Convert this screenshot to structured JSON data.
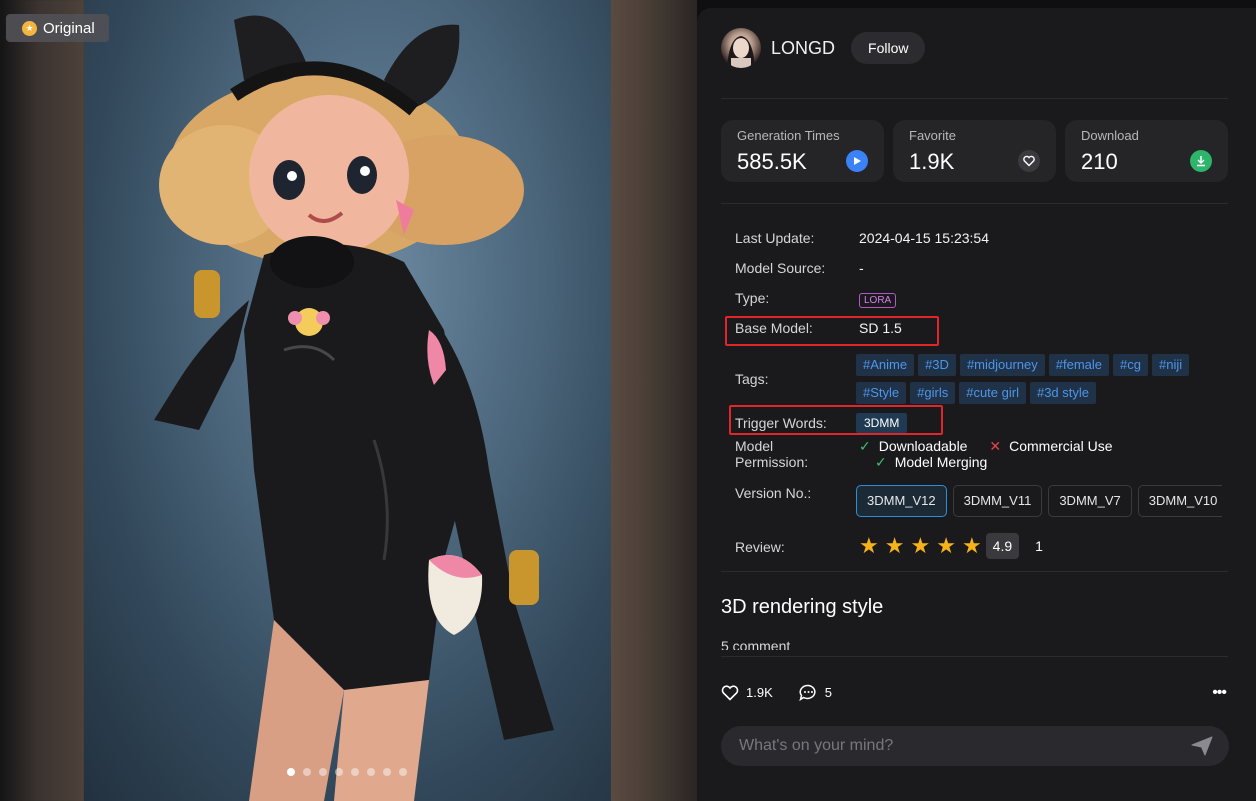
{
  "viewer": {
    "badge_label": "Original",
    "dots_total": 8,
    "dots_active_index": 0
  },
  "author": {
    "name": "LONGD",
    "follow_label": "Follow"
  },
  "stats": [
    {
      "label": "Generation Times",
      "value": "585.5K",
      "icon": "play-icon",
      "color": "#3b82f6"
    },
    {
      "label": "Favorite",
      "value": "1.9K",
      "icon": "heart-icon",
      "color": "#3a3a3f"
    },
    {
      "label": "Download",
      "value": "210",
      "icon": "download-icon",
      "color": "#2db56b"
    }
  ],
  "details": {
    "last_update_label": "Last Update:",
    "last_update": "2024-04-15 15:23:54",
    "model_source_label": "Model Source:",
    "model_source": "-",
    "type_label": "Type:",
    "type": "LORA",
    "base_model_label": "Base Model:",
    "base_model": "SD 1.5",
    "tags_label": "Tags:",
    "tags_row1": [
      "#Anime",
      "#3D",
      "#midjourney",
      "#female",
      "#cg",
      "#niji"
    ],
    "tags_row2": [
      "#Style",
      "#girls",
      "#cute girl",
      "#3d style"
    ],
    "trigger_label": "Trigger Words:",
    "trigger": "3DMM",
    "permission_label_1": "Model",
    "permission_label_2": "Permission:",
    "permissions": [
      {
        "label": "Downloadable",
        "allowed": true
      },
      {
        "label": "Commercial Use",
        "allowed": false
      },
      {
        "label": "Model Merging",
        "allowed": true
      }
    ],
    "version_label": "Version No.:",
    "versions": [
      "3DMM_V12",
      "3DMM_V11",
      "3DMM_V7",
      "3DMM_V10"
    ],
    "review_label": "Review:",
    "rating": 4.9,
    "rating_text": "4.9",
    "review_count": "1"
  },
  "post": {
    "title": "3D rendering style",
    "comments_text": "5 comment",
    "likes": "1.9K",
    "comment_count": "5",
    "more_label": "•••",
    "composer_placeholder": "What's on your mind?"
  }
}
